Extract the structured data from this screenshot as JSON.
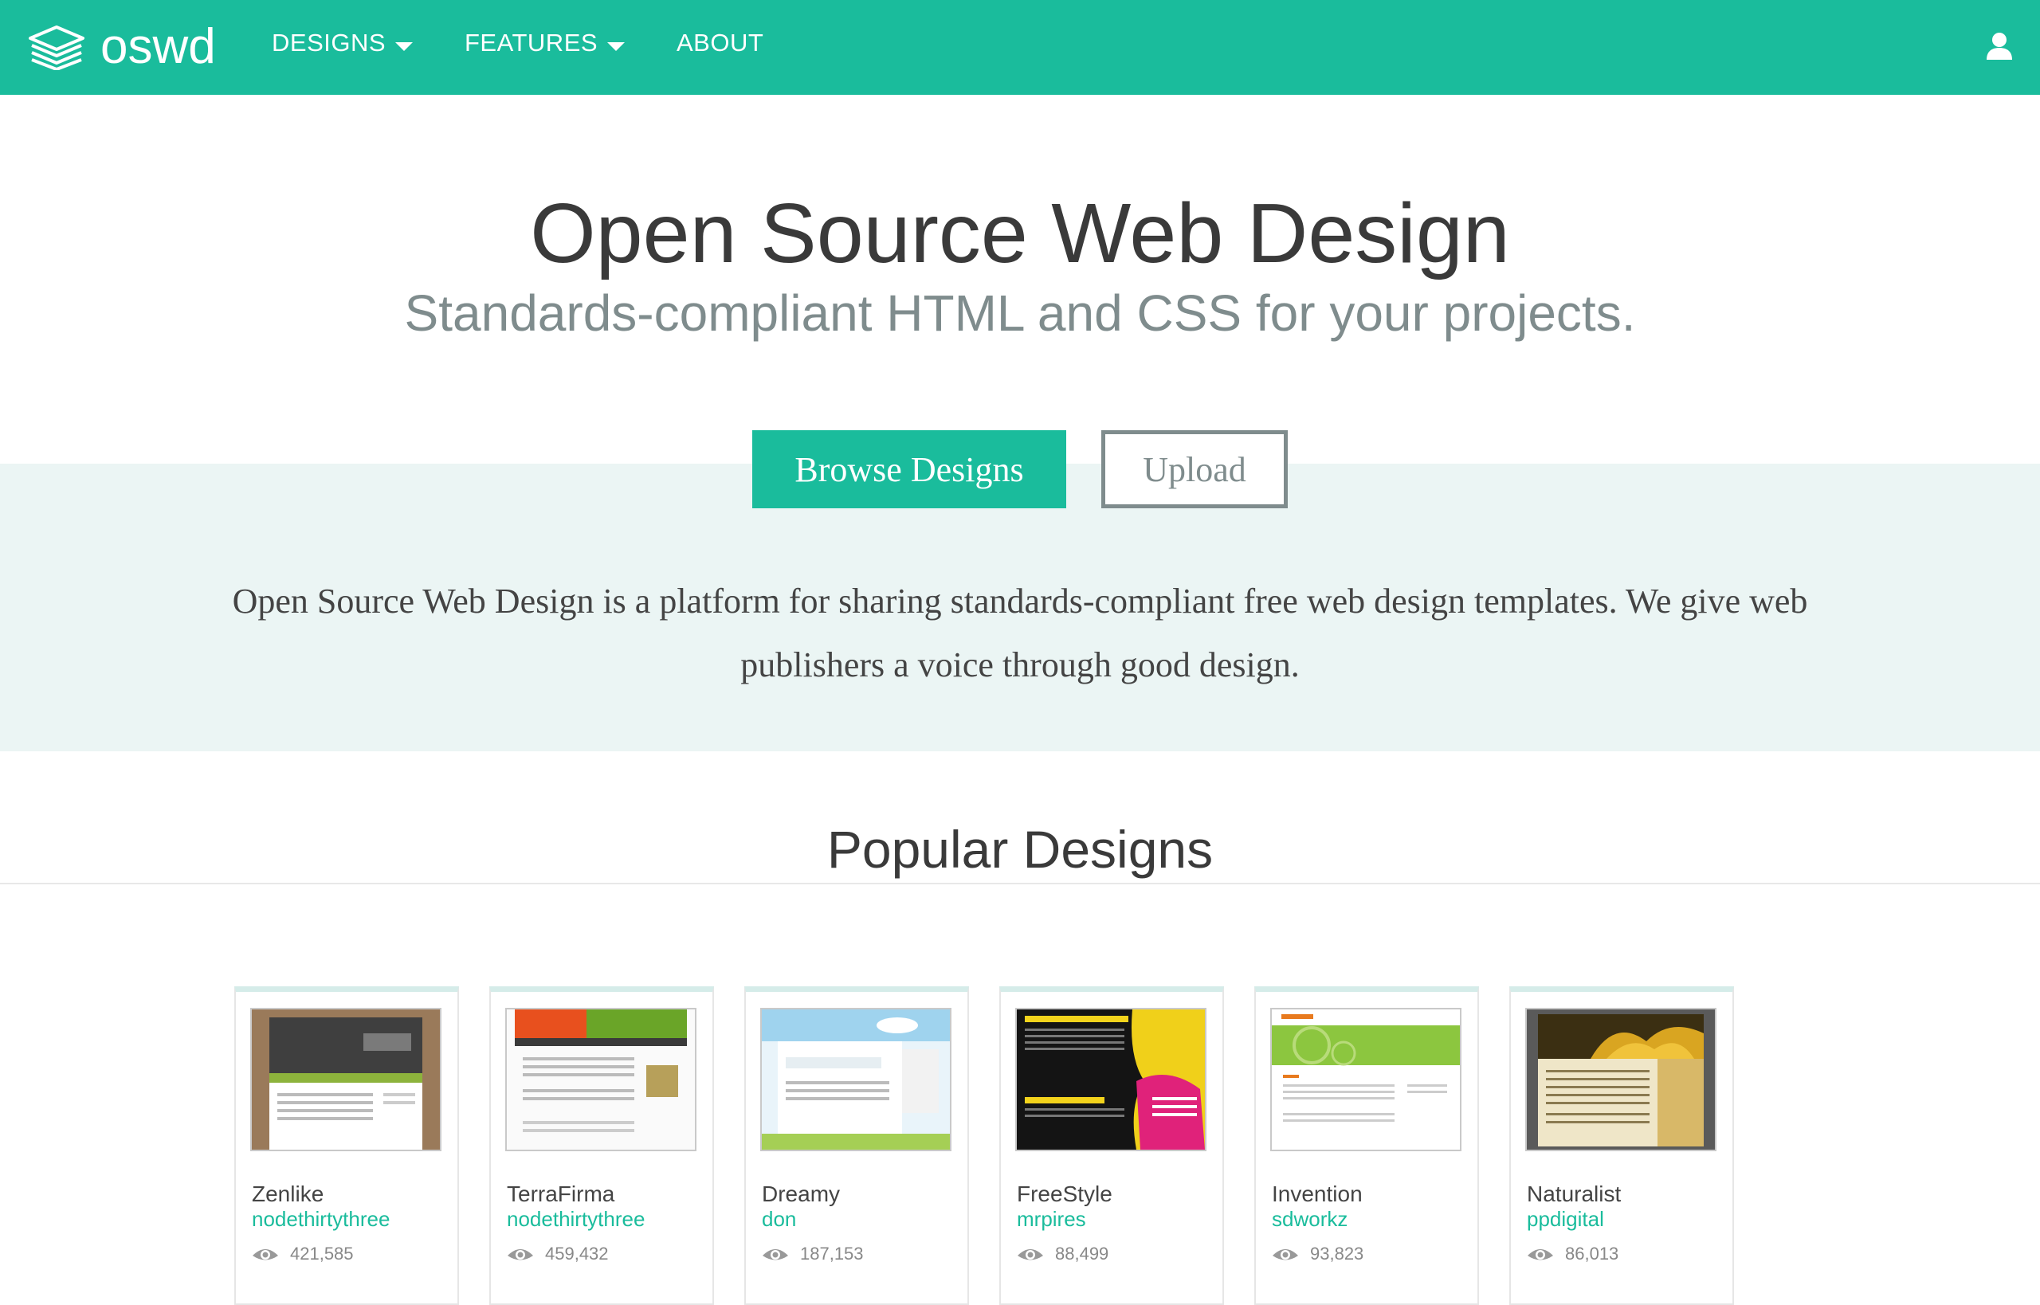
{
  "navbar": {
    "brand": "oswd",
    "items": [
      {
        "label": "DESIGNS",
        "has_caret": true
      },
      {
        "label": "FEATURES",
        "has_caret": true
      },
      {
        "label": "ABOUT",
        "has_caret": false
      }
    ],
    "user_icon": "user-icon"
  },
  "hero": {
    "title": "Open Source Web Design",
    "subtitle": "Standards-compliant HTML and CSS for your projects.",
    "browse_label": "Browse Designs",
    "upload_label": "Upload",
    "description": "Open Source Web Design is a platform for sharing standards-compliant free web design templates. We give web publishers a voice through good design."
  },
  "popular": {
    "title": "Popular Designs",
    "designs": [
      {
        "name": "Zenlike",
        "author": "nodethirtythree",
        "views": "421,585"
      },
      {
        "name": "TerraFirma",
        "author": "nodethirtythree",
        "views": "459,432"
      },
      {
        "name": "Dreamy",
        "author": "don",
        "views": "187,153"
      },
      {
        "name": "FreeStyle",
        "author": "mrpires",
        "views": "88,499"
      },
      {
        "name": "Invention",
        "author": "sdworkz",
        "views": "93,823"
      },
      {
        "name": "Naturalist",
        "author": "ppdigital",
        "views": "86,013"
      }
    ]
  },
  "colors": {
    "accent": "#1abc9c",
    "band": "#ebf5f4",
    "muted": "#7f8c8d",
    "text": "#3a3a3a"
  }
}
